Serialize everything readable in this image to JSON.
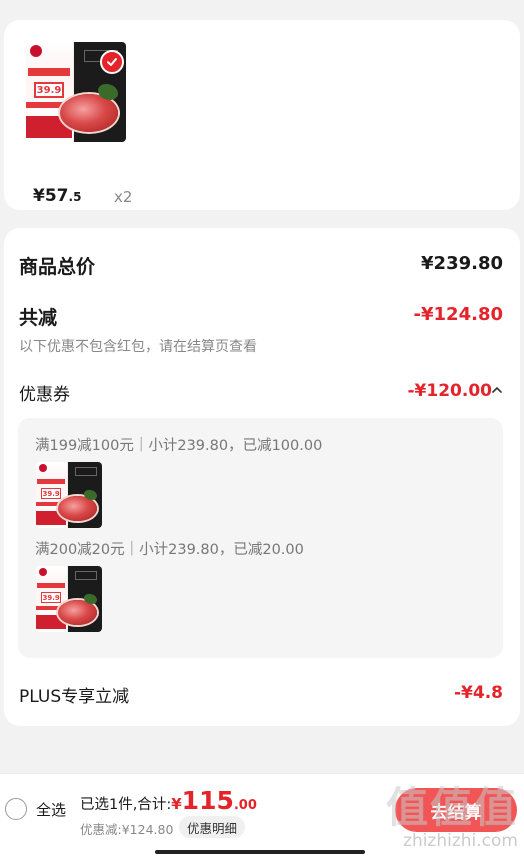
{
  "cart_item": {
    "thumb_price": "39.9",
    "price_yen": "¥",
    "price_int": "57",
    "price_dec": ".5",
    "quantity": "x2"
  },
  "summary": {
    "total_label": "商品总价",
    "total_value": "¥239.80",
    "reduce_label": "共减",
    "reduce_value": "-¥124.80",
    "note": "以下优惠不包含红包，请在结算页查看",
    "coupon_label": "优惠券",
    "coupon_value": "-¥120.00",
    "coupons": [
      {
        "text": "满199减100元｜小计239.80，已减100.00"
      },
      {
        "text": "满200减20元｜小计239.80，已减20.00"
      }
    ],
    "plus_label": "PLUS专享立减",
    "plus_value": "-¥4.8"
  },
  "bottom_bar": {
    "select_all": "全选",
    "selected_total_label": "已选1件,合计:",
    "total_yen": "¥",
    "total_int": "115",
    "total_dec": ".00",
    "discount_text": "优惠减:¥124.80",
    "detail_button": "优惠明细",
    "checkout_button": "去结算",
    "watermark_zh": "值值值",
    "watermark_en": "zhizhizhi.com"
  },
  "colors": {
    "accent_red": "#e4242a",
    "checkout_bg": "#f25555"
  }
}
